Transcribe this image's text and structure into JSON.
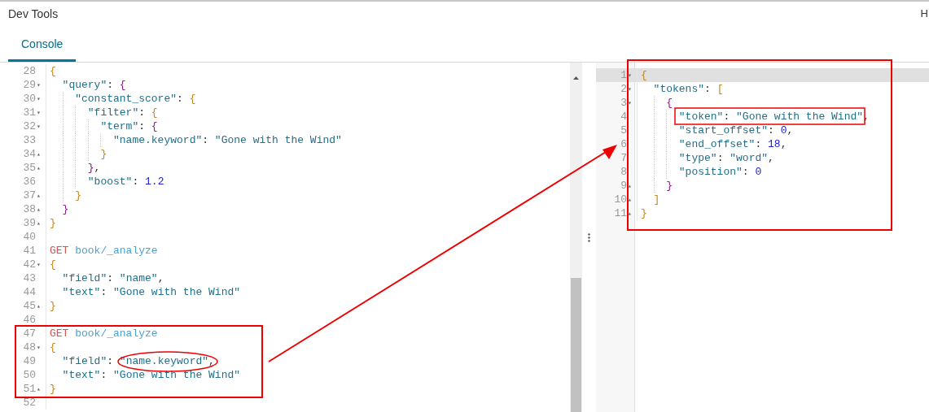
{
  "app": {
    "title": "Dev Tools",
    "corner_text": "H"
  },
  "tabs": [
    {
      "label": "Console",
      "selected": true
    }
  ],
  "request_editor": {
    "lines": [
      {
        "number": "28",
        "tokens": [
          {
            "kind": "brace",
            "text": "{"
          }
        ]
      },
      {
        "number": "29",
        "fold_marker": "▾",
        "tokens": [
          {
            "kind": "key",
            "text": "  \"query\""
          },
          {
            "kind": "punct",
            "text": ": "
          },
          {
            "kind": "brace2",
            "text": "{"
          }
        ]
      },
      {
        "number": "30",
        "fold_marker": "▾",
        "tokens": [
          {
            "kind": "key",
            "text": "    \"constant_score\""
          },
          {
            "kind": "punct",
            "text": ": "
          },
          {
            "kind": "brace",
            "text": "{"
          }
        ]
      },
      {
        "number": "31",
        "fold_marker": "▾",
        "tokens": [
          {
            "kind": "key",
            "text": "      \"filter\""
          },
          {
            "kind": "punct",
            "text": ": "
          },
          {
            "kind": "brace",
            "text": "{"
          }
        ]
      },
      {
        "number": "32",
        "fold_marker": "▾",
        "tokens": [
          {
            "kind": "key",
            "text": "        \"term\""
          },
          {
            "kind": "punct",
            "text": ": "
          },
          {
            "kind": "brace2",
            "text": "{"
          }
        ]
      },
      {
        "number": "33",
        "tokens": [
          {
            "kind": "key",
            "text": "          \"name.keyword\""
          },
          {
            "kind": "punct",
            "text": ": "
          },
          {
            "kind": "string",
            "text": "\"Gone with the Wind\""
          }
        ]
      },
      {
        "number": "34",
        "fold_marker": "▴",
        "tokens": [
          {
            "kind": "brace",
            "text": "        }"
          }
        ]
      },
      {
        "number": "35",
        "fold_marker": "▴",
        "tokens": [
          {
            "kind": "brace2",
            "text": "      }"
          },
          {
            "kind": "punct",
            "text": ","
          }
        ]
      },
      {
        "number": "36",
        "tokens": [
          {
            "kind": "key",
            "text": "      \"boost\""
          },
          {
            "kind": "punct",
            "text": ": "
          },
          {
            "kind": "number",
            "text": "1.2"
          }
        ]
      },
      {
        "number": "37",
        "fold_marker": "▴",
        "tokens": [
          {
            "kind": "brace",
            "text": "    }"
          }
        ]
      },
      {
        "number": "38",
        "fold_marker": "▴",
        "tokens": [
          {
            "kind": "brace2",
            "text": "  }"
          }
        ]
      },
      {
        "number": "39",
        "fold_marker": "▴",
        "tokens": [
          {
            "kind": "brace",
            "text": "}"
          }
        ]
      },
      {
        "number": "40"
      },
      {
        "number": "41",
        "tokens": [
          {
            "kind": "method",
            "text": "GET"
          },
          {
            "kind": "path",
            "text": "book/_analyze"
          }
        ]
      },
      {
        "number": "42",
        "fold_marker": "▾",
        "tokens": [
          {
            "kind": "brace",
            "text": "{"
          }
        ]
      },
      {
        "number": "43",
        "tokens": [
          {
            "kind": "key",
            "text": "  \"field\""
          },
          {
            "kind": "punct",
            "text": ": "
          },
          {
            "kind": "string",
            "text": "\"name\""
          },
          {
            "kind": "punct",
            "text": ","
          }
        ]
      },
      {
        "number": "44",
        "tokens": [
          {
            "kind": "key",
            "text": "  \"text\""
          },
          {
            "kind": "punct",
            "text": ": "
          },
          {
            "kind": "string",
            "text": "\"Gone with the Wind\""
          }
        ]
      },
      {
        "number": "45",
        "fold_marker": "▴",
        "tokens": [
          {
            "kind": "brace",
            "text": "}"
          }
        ]
      },
      {
        "number": "46"
      },
      {
        "number": "47",
        "tokens": [
          {
            "kind": "method",
            "text": "GET"
          },
          {
            "kind": "path",
            "text": "book/_analyze"
          }
        ]
      },
      {
        "number": "48",
        "fold_marker": "▾",
        "tokens": [
          {
            "kind": "brace",
            "text": "{"
          }
        ]
      },
      {
        "number": "49",
        "tokens": [
          {
            "kind": "key",
            "text": "  \"field\""
          },
          {
            "kind": "punct",
            "text": ": "
          },
          {
            "kind": "string",
            "text": "\"name.keyword\""
          },
          {
            "kind": "punct",
            "text": ","
          }
        ]
      },
      {
        "number": "50",
        "tokens": [
          {
            "kind": "key",
            "text": "  \"text\""
          },
          {
            "kind": "punct",
            "text": ": "
          },
          {
            "kind": "string",
            "text": "\"Gone with the Wind\""
          }
        ]
      },
      {
        "number": "51",
        "fold_marker": "▴",
        "tokens": [
          {
            "kind": "brace",
            "text": "}"
          }
        ]
      },
      {
        "number": "52"
      }
    ]
  },
  "response_viewer": {
    "lines": [
      {
        "number": "1",
        "fold_marker": "▾",
        "tokens": [
          {
            "kind": "brace",
            "text": "{"
          }
        ]
      },
      {
        "number": "2",
        "fold_marker": "▾",
        "tokens": [
          {
            "kind": "key",
            "text": "  \"tokens\""
          },
          {
            "kind": "punct",
            "text": ": "
          },
          {
            "kind": "brace",
            "text": "["
          }
        ]
      },
      {
        "number": "3",
        "fold_marker": "▾",
        "tokens": [
          {
            "kind": "brace2",
            "text": "    {"
          }
        ]
      },
      {
        "number": "4",
        "tokens": [
          {
            "kind": "key",
            "text": "      \"token\""
          },
          {
            "kind": "punct",
            "text": ": "
          },
          {
            "kind": "string",
            "text": "\"Gone with the Wind\""
          },
          {
            "kind": "punct",
            "text": ","
          }
        ]
      },
      {
        "number": "5",
        "tokens": [
          {
            "kind": "key",
            "text": "      \"start_offset\""
          },
          {
            "kind": "punct",
            "text": ": "
          },
          {
            "kind": "number",
            "text": "0"
          },
          {
            "kind": "punct",
            "text": ","
          }
        ]
      },
      {
        "number": "6",
        "tokens": [
          {
            "kind": "key",
            "text": "      \"end_offset\""
          },
          {
            "kind": "punct",
            "text": ": "
          },
          {
            "kind": "number",
            "text": "18"
          },
          {
            "kind": "punct",
            "text": ","
          }
        ]
      },
      {
        "number": "7",
        "tokens": [
          {
            "kind": "key",
            "text": "      \"type\""
          },
          {
            "kind": "punct",
            "text": ": "
          },
          {
            "kind": "string",
            "text": "\"word\""
          },
          {
            "kind": "punct",
            "text": ","
          }
        ]
      },
      {
        "number": "8",
        "tokens": [
          {
            "kind": "key",
            "text": "      \"position\""
          },
          {
            "kind": "punct",
            "text": ": "
          },
          {
            "kind": "number",
            "text": "0"
          }
        ]
      },
      {
        "number": "9",
        "fold_marker": "▴",
        "tokens": [
          {
            "kind": "brace2",
            "text": "    }"
          }
        ]
      },
      {
        "number": "10",
        "fold_marker": "▴",
        "tokens": [
          {
            "kind": "brace",
            "text": "  ]"
          }
        ]
      },
      {
        "number": "11",
        "fold_marker": "▴",
        "tokens": [
          {
            "kind": "brace",
            "text": "}"
          }
        ]
      }
    ]
  }
}
